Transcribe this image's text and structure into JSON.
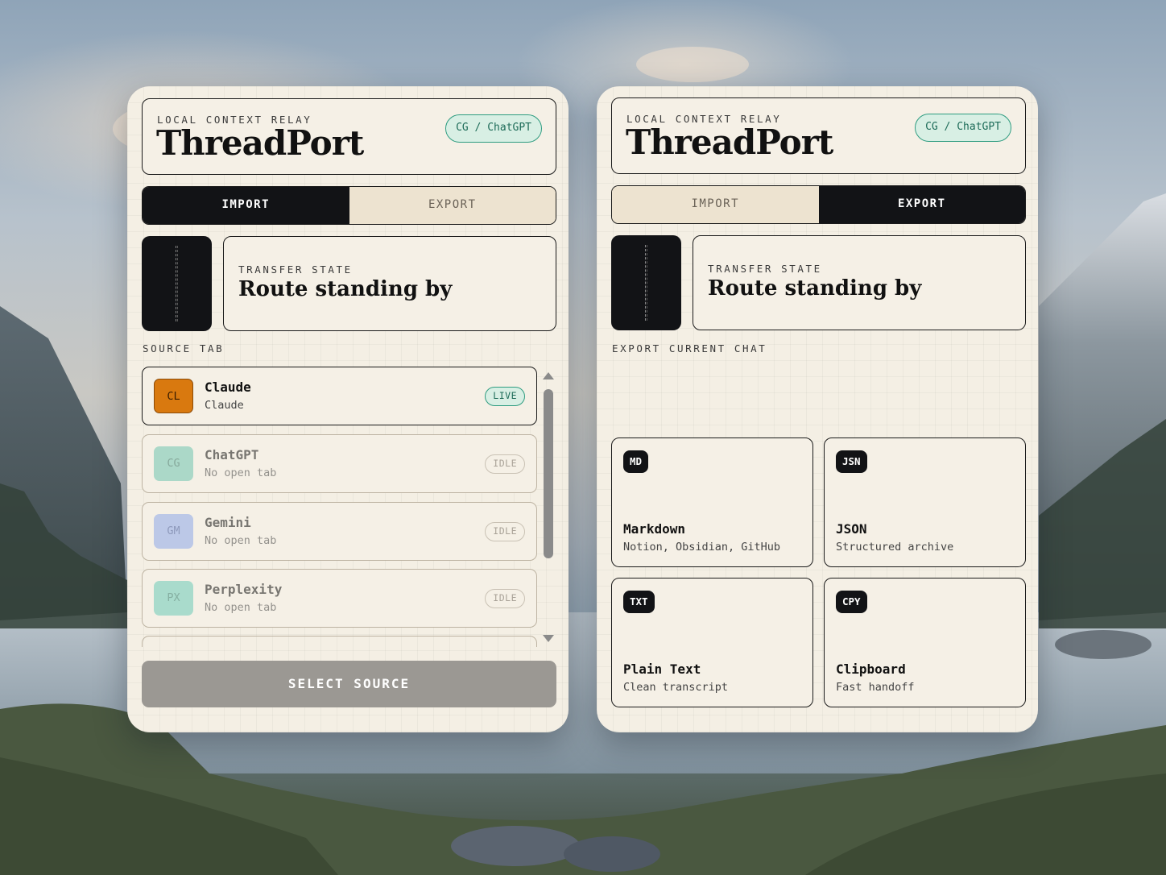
{
  "colors": {
    "accent_green": "#2e9c80",
    "dark": "#121316",
    "panel": "#f4efe4",
    "claude_orange": "#d9790f",
    "chatgpt_teal": "#6fc6b0",
    "gemini_blue": "#8ea9e8",
    "perplexity_teal": "#6ccbb8"
  },
  "left": {
    "eyebrow": "LOCAL CONTEXT RELAY",
    "brand": "ThreadPort",
    "connection_pill": "CG / ChatGPT",
    "tabs": {
      "import": "IMPORT",
      "export": "EXPORT",
      "active": "import"
    },
    "state": {
      "label": "TRANSFER STATE",
      "title": "Route standing by"
    },
    "section_label": "SOURCE TAB",
    "sources": [
      {
        "abbr": "CL",
        "name": "Claude",
        "sub": "Claude",
        "status": "LIVE"
      },
      {
        "abbr": "CG",
        "name": "ChatGPT",
        "sub": "No open tab",
        "status": "IDLE"
      },
      {
        "abbr": "GM",
        "name": "Gemini",
        "sub": "No open tab",
        "status": "IDLE"
      },
      {
        "abbr": "PX",
        "name": "Perplexity",
        "sub": "No open tab",
        "status": "IDLE"
      }
    ],
    "action_button": "SELECT SOURCE",
    "icons": [
      "scroll-up-arrow-icon",
      "scroll-down-arrow-icon"
    ]
  },
  "right": {
    "eyebrow": "LOCAL CONTEXT RELAY",
    "brand": "ThreadPort",
    "connection_pill": "CG / ChatGPT",
    "tabs": {
      "import": "IMPORT",
      "export": "EXPORT",
      "active": "export"
    },
    "state": {
      "label": "TRANSFER STATE",
      "title": "Route standing by"
    },
    "section_label": "EXPORT CURRENT CHAT",
    "formats": [
      {
        "badge": "MD",
        "title": "Markdown",
        "sub": "Notion, Obsidian, GitHub"
      },
      {
        "badge": "JSN",
        "title": "JSON",
        "sub": "Structured archive"
      },
      {
        "badge": "TXT",
        "title": "Plain Text",
        "sub": "Clean transcript"
      },
      {
        "badge": "CPY",
        "title": "Clipboard",
        "sub": "Fast handoff"
      }
    ]
  }
}
